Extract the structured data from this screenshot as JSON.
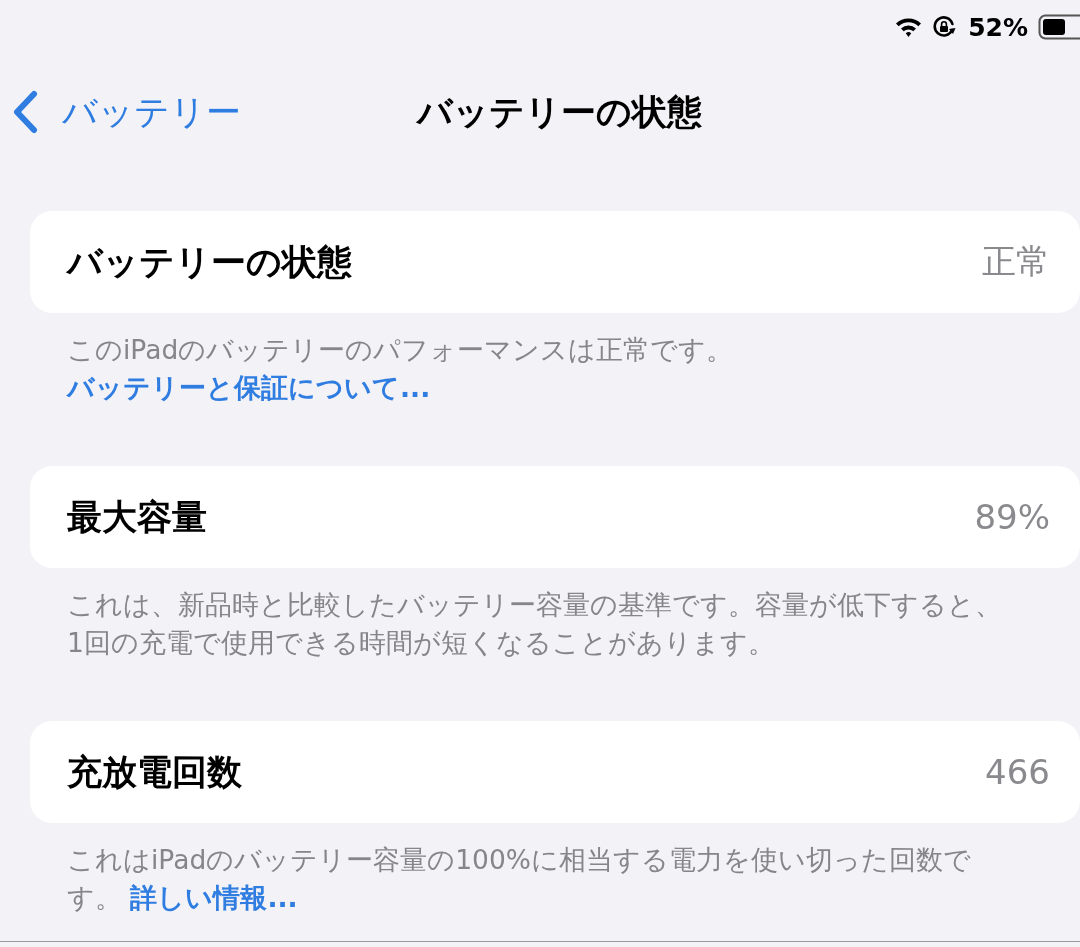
{
  "status_bar": {
    "battery_percent": "52%"
  },
  "nav_bar": {
    "back_label": "バッテリー",
    "title": "バッテリーの状態"
  },
  "sections": [
    {
      "label": "バッテリーの状態",
      "value": "正常",
      "footer": {
        "text": "このiPadのバッテリーのパフォーマンスは正常です。",
        "link": "バッテリーと保証について..."
      }
    },
    {
      "label": "最大容量",
      "value": "89%",
      "footer": {
        "text": "これは、新品時と比較したバッテリー容量の基準です。容量が低下すると、1回の充電で使用できる時間が短くなることがあります。"
      }
    },
    {
      "label": "充放電回数",
      "value": "466",
      "footer": {
        "text": "これはiPadのバッテリー容量の100%に相当する電力を使い切った回数です。 ",
        "link": "詳しい情報..."
      }
    }
  ]
}
